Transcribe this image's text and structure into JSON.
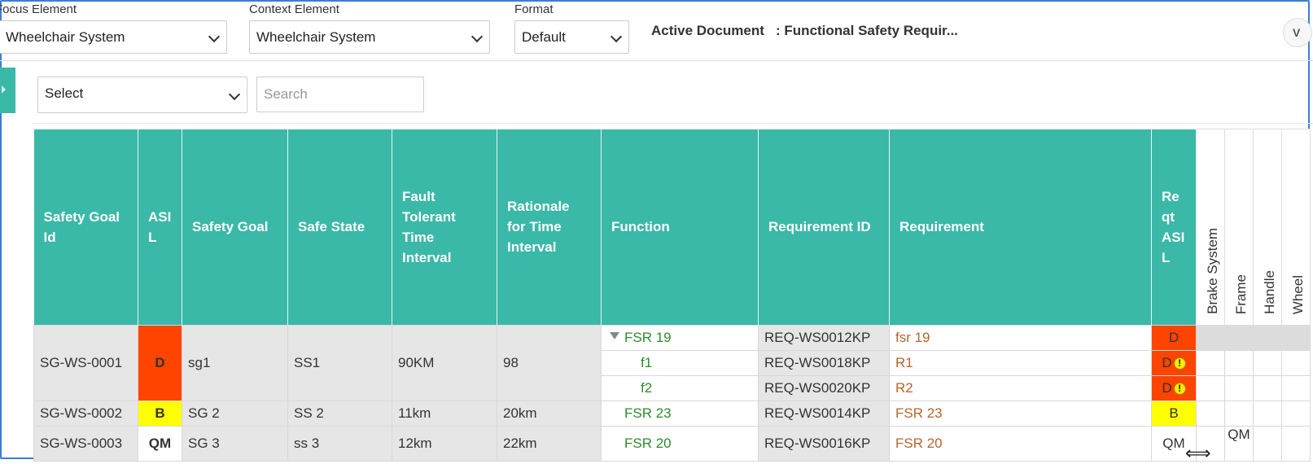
{
  "filters": {
    "focus": {
      "label": "Focus Element",
      "value": "Wheelchair System"
    },
    "context": {
      "label": "Context Element",
      "value": "Wheelchair System"
    },
    "format": {
      "label": "Format",
      "value": "Default"
    },
    "active_document": "Active Document   : Functional Safety Requir..."
  },
  "corner_button": {
    "text": "V"
  },
  "toolbar": {
    "select_value": "Select",
    "search_placeholder": "Search"
  },
  "table": {
    "headers": [
      "Safety Goal Id",
      "ASIL",
      "Safety Goal",
      "Safe State",
      "Fault Tolerant Time Interval",
      "Rationale for Time Interval",
      "Function",
      "Requirement ID",
      "Requirement",
      "Reqt ASIL"
    ],
    "vertical_headers": [
      "Brake System",
      "Frame",
      "Handle",
      "Wheel"
    ],
    "goals": [
      {
        "id": "SG-WS-0001",
        "asil": "D",
        "goal": "sg1",
        "safe_state": "SS1",
        "ftti": "90KM",
        "rationale": "98",
        "asil_color": "#ff4400",
        "rows": [
          {
            "function": "FSR 19",
            "req_id": "REQ-WS0012KP",
            "requirement": "fsr 19",
            "reqt_asil": "D",
            "warning": false
          },
          {
            "function": "f1",
            "req_id": "REQ-WS0018KP",
            "requirement": "R1",
            "reqt_asil": "D",
            "warning": true
          },
          {
            "function": "f2",
            "req_id": "REQ-WS0020KP",
            "requirement": "R2",
            "reqt_asil": "D",
            "warning": true
          }
        ]
      },
      {
        "id": "SG-WS-0002",
        "asil": "B",
        "goal": "SG 2",
        "safe_state": "SS 2",
        "ftti": "11km",
        "rationale": "20km",
        "asil_color": "#ffff00",
        "rows": [
          {
            "function": "FSR 23",
            "req_id": "REQ-WS0014KP",
            "requirement": "FSR 23",
            "reqt_asil": "B",
            "warning": false
          }
        ]
      },
      {
        "id": "SG-WS-0003",
        "asil": "QM",
        "goal": "SG 3",
        "safe_state": "ss 3",
        "ftti": "12km",
        "rationale": "22km",
        "rows": [
          {
            "function": "FSR 20",
            "req_id": "REQ-WS0016KP",
            "requirement": "FSR 20",
            "reqt_asil": "QM",
            "warning": false,
            "frame_value": "QM"
          }
        ]
      }
    ]
  },
  "warning_symbol": "!",
  "colors": {
    "header_teal": "#3ab8a8",
    "asil_d": "#ff4400",
    "asil_b": "#ffff00",
    "function_green": "#2e8b2e",
    "requirement_brown": "#b5652d",
    "frame_blue": "#3a7fd5"
  }
}
